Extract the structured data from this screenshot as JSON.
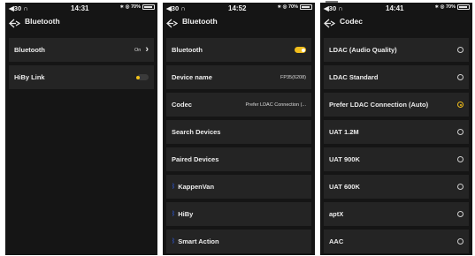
{
  "screens": [
    {
      "status": {
        "left": "◀30 ∩",
        "time": "14:31",
        "right": "∗ ◎ 70%"
      },
      "title": "Bluetooth",
      "rows": [
        {
          "label": "Bluetooth",
          "value": "On"
        },
        {
          "label": "HiBy Link",
          "toggle": "off"
        }
      ]
    },
    {
      "status": {
        "left": "◀30 ∩",
        "time": "14:52",
        "right": "∗ ◎ 70%"
      },
      "title": "Bluetooth",
      "rows": [
        {
          "label": "Bluetooth",
          "toggle": "on"
        },
        {
          "label": "Device name",
          "value": "FP35(6208)"
        },
        {
          "label": "Codec",
          "value": "Prefer LDAC Connection (..."
        },
        {
          "label": "Search Devices"
        },
        {
          "label": "Paired Devices"
        },
        {
          "label": "KappenVan",
          "icon": "bluetooth-icon"
        },
        {
          "label": "HiBy",
          "icon": "bluetooth-icon"
        },
        {
          "label": "Smart Action",
          "icon": "bluetooth-icon"
        }
      ]
    },
    {
      "status": {
        "left": "◀30 ∩",
        "time": "14:41",
        "right": "∗ ◎ 70%"
      },
      "title": "Codec",
      "options": [
        {
          "label": "LDAC (Audio Quality)",
          "selected": false
        },
        {
          "label": "LDAC Standard",
          "selected": false
        },
        {
          "label": "Prefer LDAC Connection (Auto)",
          "selected": true
        },
        {
          "label": "UAT 1.2M",
          "selected": false
        },
        {
          "label": "UAT 900K",
          "selected": false
        },
        {
          "label": "UAT 600K",
          "selected": false
        },
        {
          "label": "aptX",
          "selected": false
        },
        {
          "label": "AAC",
          "selected": false
        }
      ]
    }
  ],
  "colors": {
    "accent": "#f0bd1c",
    "background": "#151515",
    "row": "#242424",
    "bluetooth_icon": "#2f63ff"
  },
  "icons": {
    "back": "back-arrow-icon",
    "bluetooth": "bluetooth-icon",
    "chevron": "chevron-right-icon"
  }
}
